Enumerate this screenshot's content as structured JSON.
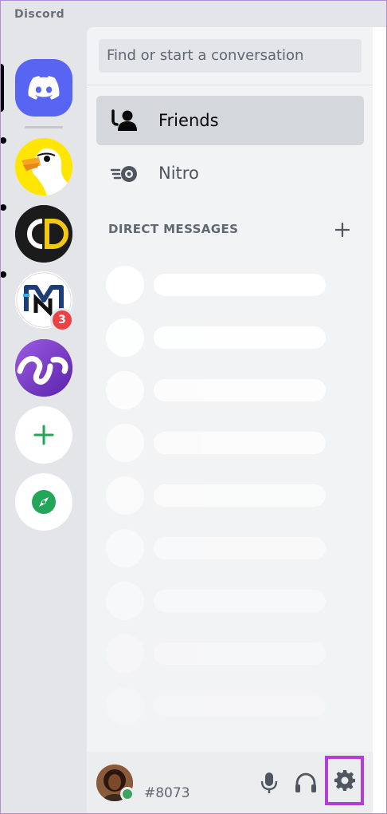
{
  "app": {
    "title": "Discord"
  },
  "server_rail": {
    "home": {
      "icon": "discord-logo-icon"
    },
    "servers": [
      {
        "name": "goose-server",
        "icon": "goose-avatar"
      },
      {
        "name": "cd-server",
        "icon": "cd-letters-avatar"
      },
      {
        "name": "mn-server",
        "icon": "mn-logo-avatar",
        "badge": "3"
      },
      {
        "name": "purple-server",
        "icon": "purple-abstract-avatar"
      }
    ],
    "add_server_icon": "plus-icon",
    "explore_icon": "compass-icon",
    "accent_green": "#23a55a"
  },
  "dm_panel": {
    "search_placeholder": "Find or start a conversation",
    "nav": [
      {
        "label": "Friends",
        "icon": "friends-icon",
        "selected": true
      },
      {
        "label": "Nitro",
        "icon": "nitro-icon",
        "selected": false
      }
    ],
    "direct_messages_header": "DIRECT MESSAGES",
    "add_dm_icon": "plus-icon",
    "placeholder_rows": 9
  },
  "user_panel": {
    "tag": "#8073",
    "status": "online",
    "status_color": "#3ba55d",
    "controls": [
      {
        "name": "microphone",
        "icon": "microphone-icon"
      },
      {
        "name": "headphones",
        "icon": "headphones-icon"
      },
      {
        "name": "settings",
        "icon": "gear-icon",
        "highlighted": true
      }
    ],
    "highlight_color": "#b03fd4"
  },
  "colors": {
    "brand": "#5865f2",
    "badge": "#ed4245"
  }
}
